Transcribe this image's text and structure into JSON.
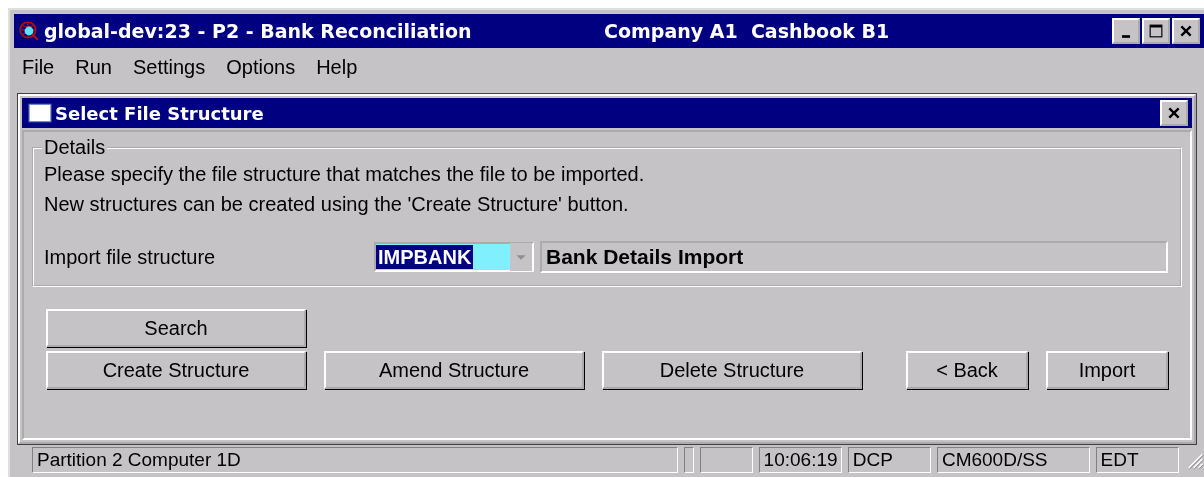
{
  "window": {
    "title": "global-dev:23 - P2 - Bank Reconciliation",
    "context": "Company A1  Cashbook B1"
  },
  "menu": [
    "File",
    "Run",
    "Settings",
    "Options",
    "Help"
  ],
  "dialog": {
    "title": "Select File Structure",
    "group": {
      "label": "Details",
      "lines": [
        "Please specify the file structure that matches the file to be imported.",
        "New structures can be created using the 'Create Structure' button."
      ],
      "field": {
        "label": "Import file structure",
        "value": "IMPBANK",
        "focused": true,
        "description": "Bank Details Import"
      }
    },
    "search_button": "Search",
    "structure_buttons": [
      "Create Structure",
      "Amend Structure",
      "Delete Structure"
    ],
    "nav_buttons": [
      "< Back",
      "Import"
    ]
  },
  "status_bar": [
    {
      "text": "Partition 2 Computer 1D",
      "kind": "wide"
    },
    {
      "kind": "tiny"
    },
    {
      "kind": "blank"
    },
    {
      "text": "10:06:19",
      "kind": "cell"
    },
    {
      "text": "DCP",
      "kind": "cell"
    },
    {
      "text": "CM600D/SS",
      "kind": "mid"
    },
    {
      "text": "EDT",
      "kind": "cell"
    }
  ]
}
